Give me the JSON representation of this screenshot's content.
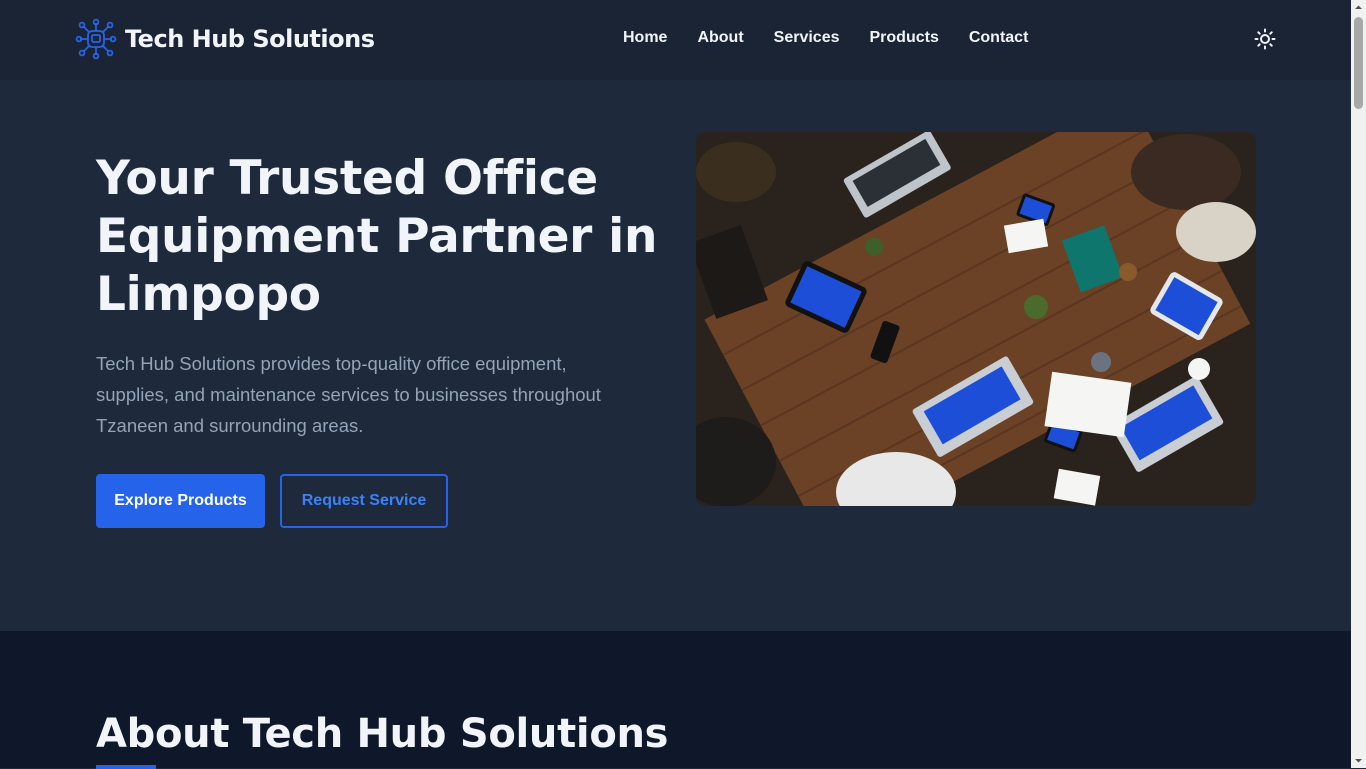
{
  "brand": {
    "name": "Tech Hub Solutions",
    "accent": "#2563eb"
  },
  "nav": {
    "items": [
      "Home",
      "About",
      "Services",
      "Products",
      "Contact"
    ]
  },
  "theme_toggle_icon": "sun-icon",
  "hero": {
    "title": "Your Trusted Office Equipment Partner in Limpopo",
    "description": "Tech Hub Solutions provides top-quality office equipment, supplies, and maintenance services to businesses throughout Tzaneen and surrounding areas.",
    "primary_button": "Explore Products",
    "secondary_button": "Request Service",
    "image_alt": "Team collaborating around a table with laptops and tablets"
  },
  "about": {
    "title": "About Tech Hub Solutions"
  }
}
